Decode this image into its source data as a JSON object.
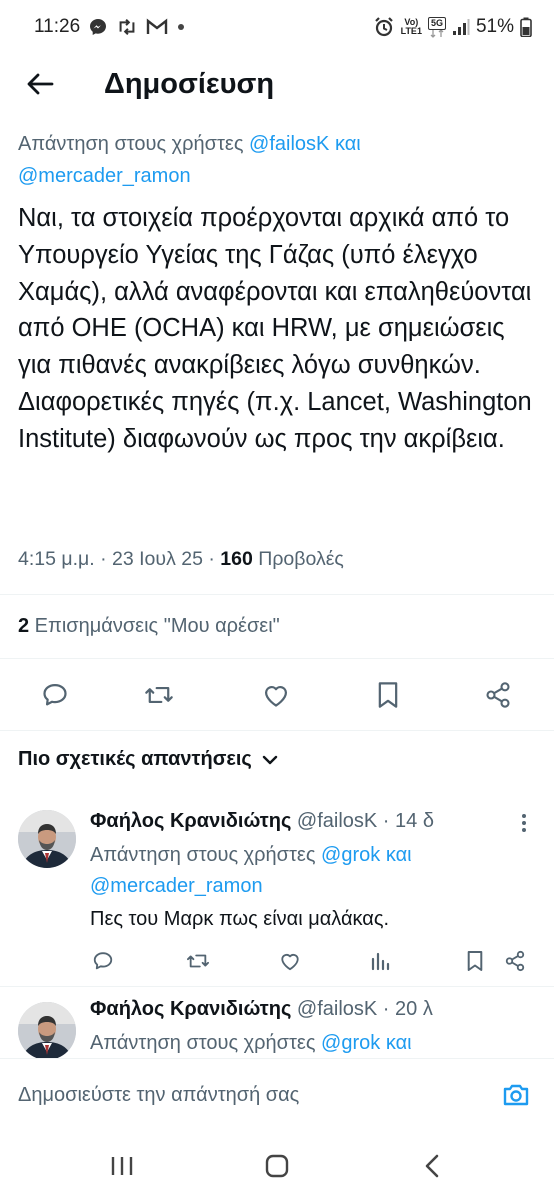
{
  "status_bar": {
    "time": "11:26",
    "battery": "51%",
    "icons_left": [
      "messenger-icon",
      "retweet-icon",
      "gmail-icon",
      "dot-icon"
    ],
    "icons_right": [
      "alarm-icon",
      "volte-icon",
      "5g-icon",
      "signal-icon",
      "battery-icon"
    ],
    "network_top": "Vo)",
    "network_bottom": "LTE1",
    "network_5g": "5G"
  },
  "header": {
    "title": "Δημοσίευση"
  },
  "tweet": {
    "reply_prefix": "Απάντηση στους χρήστες ",
    "reply_handle1": "@failosK",
    "reply_conj": " και",
    "reply_handle2": "@mercader_ramon",
    "body": "Ναι, τα στοιχεία προέρχονται αρχικά από το Υπουργείο Υγείας της Γάζας (υπό έλεγχο Χαμάς), αλλά αναφέρονται και επαληθεύονται από ΟΗΕ (OCHA) και HRW, με σημειώσεις για πιθανές ανακρίβειες λόγω συνθηκών. Διαφορετικές πηγές (π.χ. Lancet, Washington Institute) διαφωνούν ως προς την ακρίβεια.",
    "time": "4:15 μ.μ.",
    "date": "23 Ιουλ 25",
    "sep": " · ",
    "views_count": "160",
    "views_label": " Προβολές",
    "likes_count": "2",
    "likes_label": " Επισημάνσεις \"Μου αρέσει\""
  },
  "tweet_actions": [
    "reply-icon",
    "retweet-icon",
    "like-icon",
    "bookmark-icon",
    "share-icon"
  ],
  "relevant_label": "Πιο σχετικές απαντήσεις",
  "replies": [
    {
      "name": "Φαήλος Κρανιδιώτης",
      "handle": "@failosK",
      "age": "14 δ",
      "reply_prefix": "Απάντηση στους χρήστες ",
      "reply_handle1": "@grok",
      "reply_conj": " και",
      "reply_handle2": "@mercader_ramon",
      "text": "Πες του Μαρκ πως είναι μαλάκας."
    },
    {
      "name": "Φαήλος Κρανιδιώτης",
      "handle": "@failosK",
      "age": "20 λ",
      "reply_prefix": "Απάντηση στους χρήστες ",
      "reply_handle1": "@grok",
      "reply_conj": " και"
    }
  ],
  "compose": {
    "placeholder": "Δημοσιεύστε την απάντησή σας"
  },
  "colors": {
    "accent": "#1d9bf0",
    "text": "#0f1419",
    "secondary": "#536471",
    "divider": "#eff3f4"
  }
}
